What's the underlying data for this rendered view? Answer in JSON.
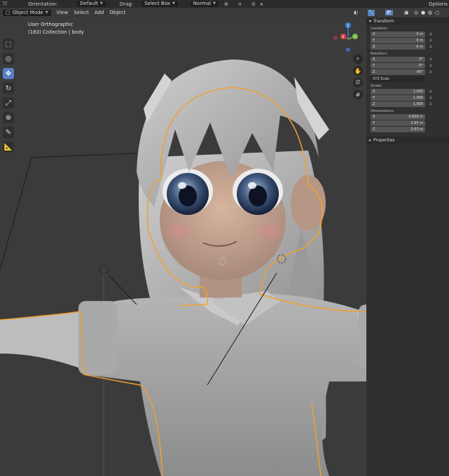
{
  "topbar": {
    "orientation_label": "Orientation:",
    "orientation_value": "Default",
    "drag_label": "Drag:",
    "drag_value": "Select Box",
    "pivot_value": "Normal",
    "options_label": "Options"
  },
  "header": {
    "mode": "Object Mode",
    "menu": [
      "View",
      "Select",
      "Add",
      "Object"
    ]
  },
  "viewport": {
    "view_name": "User Orthographic",
    "collection_info": "(183) Collection | body",
    "gizmo": {
      "z": "Z",
      "y": "Y",
      "x": "X"
    }
  },
  "toolbar": {
    "tools": [
      "select-box-icon",
      "cursor-icon",
      "move-icon",
      "rotate-icon",
      "scale-icon",
      "transform-icon",
      "annotate-icon",
      "measure-icon"
    ]
  },
  "npanel": {
    "transform_title": "Transform",
    "location_label": "Location:",
    "location": [
      {
        "axis": "X",
        "value": "0 m"
      },
      {
        "axis": "Y",
        "value": "0 m"
      },
      {
        "axis": "Z",
        "value": "0 m"
      }
    ],
    "rotation_label": "Rotation:",
    "rotation": [
      {
        "axis": "X",
        "value": "0°"
      },
      {
        "axis": "Y",
        "value": "-0°"
      },
      {
        "axis": "Z",
        "value": "-90°"
      }
    ],
    "rotation_mode": "XYZ Euler",
    "scale_label": "Scale:",
    "scale": [
      {
        "axis": "X",
        "value": "1.000"
      },
      {
        "axis": "Y",
        "value": "1.000"
      },
      {
        "axis": "Z",
        "value": "1.000"
      }
    ],
    "dimensions_label": "Dimensions:",
    "dimensions": [
      {
        "axis": "X",
        "value": "0.659 m"
      },
      {
        "axis": "Y",
        "value": "2.85 m"
      },
      {
        "axis": "Z",
        "value": "3.63 m"
      }
    ],
    "properties_title": "Properties"
  },
  "colors": {
    "selection_outline": "#f0a030",
    "active_tool": "#5680c2",
    "axis_x": "#e0404a",
    "axis_y": "#7ab83c",
    "axis_z": "#3a7ad8"
  }
}
